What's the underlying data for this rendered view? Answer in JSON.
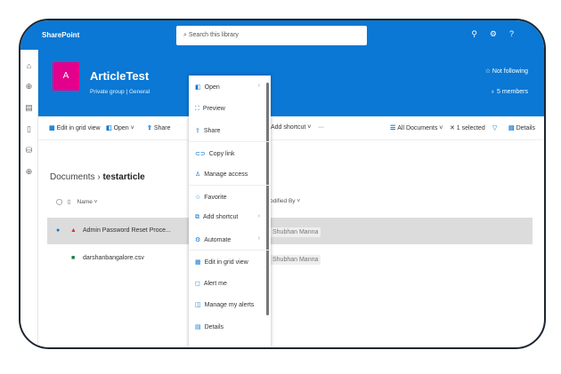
{
  "topbar": {
    "brand": "SharePoint",
    "search_placeholder": "Search this library",
    "icons": [
      "people-icon",
      "gear-icon",
      "help-icon"
    ]
  },
  "site": {
    "logo_letter": "A",
    "title": "ArticleTest",
    "subtitle": "Private group | General",
    "follow": "☆ Not following",
    "members": "♁ 5 members"
  },
  "commands": {
    "edit_grid": "Edit in grid view",
    "open": "Open ˅",
    "share": "Share",
    "add_shortcut": "Add shortcut ˅",
    "more": "···",
    "view": "All Documents ˅",
    "selected": "✕ 1 selected",
    "details": "Details"
  },
  "breadcrumb": {
    "root": "Documents",
    "current": "testarticle"
  },
  "list": {
    "col_name": "Name ˅",
    "col_modified_by": "odified By ˅",
    "rows": [
      {
        "name": "Admin Password Reset Proce...",
        "modified_by": "Shubhan Manna",
        "selected": true
      },
      {
        "name": "darshanbangalore.csv",
        "modified_by": "Shubhan Manna",
        "selected": false
      }
    ]
  },
  "menu": {
    "items": [
      {
        "label": "Open",
        "icon": "◧",
        "sub": true
      },
      {
        "label": "Preview",
        "icon": "⛶",
        "sub": false
      },
      {
        "label": "Share",
        "icon": "⇪",
        "sub": false
      },
      {
        "label": "Copy link",
        "icon": "⊂⊃",
        "sub": false
      },
      {
        "label": "Manage access",
        "icon": "♙",
        "sub": false
      },
      {
        "label": "Favorite",
        "icon": "☆",
        "sub": false
      },
      {
        "label": "Add shortcut",
        "icon": "⧉",
        "sub": true
      },
      {
        "label": "Automate",
        "icon": "⚙",
        "sub": true
      },
      {
        "label": "Edit in grid view",
        "icon": "▦",
        "sub": false
      },
      {
        "label": "Alert me",
        "icon": "◻",
        "sub": false
      },
      {
        "label": "Manage my alerts",
        "icon": "◫",
        "sub": false
      },
      {
        "label": "Details",
        "icon": "▤",
        "sub": false
      }
    ]
  }
}
